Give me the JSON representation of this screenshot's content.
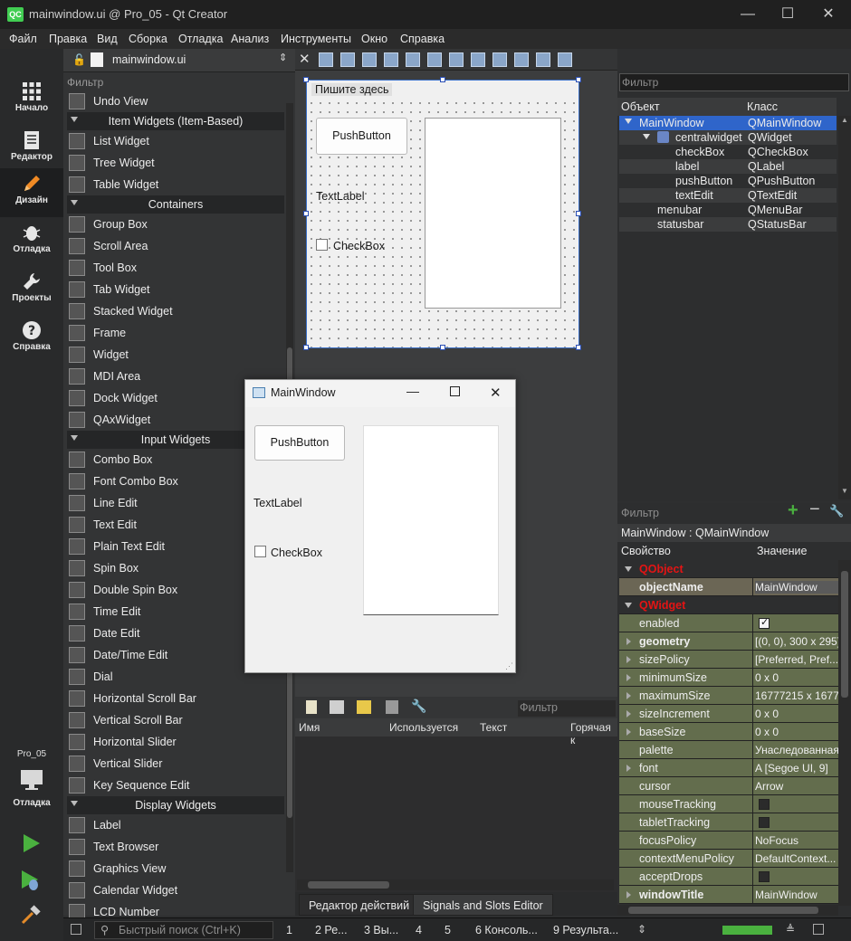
{
  "window": {
    "title": "mainwindow.ui @ Pro_05 - Qt Creator",
    "logo": "QC",
    "minimize": "—",
    "maximize": "☐",
    "close": "✕"
  },
  "menu": [
    "Файл",
    "Правка",
    "Вид",
    "Сборка",
    "Отладка",
    "Анализ",
    "Инструменты",
    "Окно",
    "Справка"
  ],
  "modes": [
    {
      "label": "Начало",
      "icon": "grid-icon"
    },
    {
      "label": "Редактор",
      "icon": "document-icon"
    },
    {
      "label": "Дизайн",
      "icon": "pencil-icon"
    },
    {
      "label": "Отладка",
      "icon": "bug-icon"
    },
    {
      "label": "Проекты",
      "icon": "wrench-icon"
    },
    {
      "label": "Справка",
      "icon": "help-icon"
    }
  ],
  "kit": {
    "project": "Pro_05",
    "config": "Отладка"
  },
  "file_combo": "mainwindow.ui",
  "widget_box": {
    "filter": "Фильтр",
    "items": [
      {
        "type": "item",
        "label": "Undo View"
      },
      {
        "type": "cat",
        "label": "Item Widgets (Item-Based)"
      },
      {
        "type": "item",
        "label": "List Widget"
      },
      {
        "type": "item",
        "label": "Tree Widget"
      },
      {
        "type": "item",
        "label": "Table Widget"
      },
      {
        "type": "cat",
        "label": "Containers"
      },
      {
        "type": "item",
        "label": "Group Box"
      },
      {
        "type": "item",
        "label": "Scroll Area"
      },
      {
        "type": "item",
        "label": "Tool Box"
      },
      {
        "type": "item",
        "label": "Tab Widget"
      },
      {
        "type": "item",
        "label": "Stacked Widget"
      },
      {
        "type": "item",
        "label": "Frame"
      },
      {
        "type": "item",
        "label": "Widget"
      },
      {
        "type": "item",
        "label": "MDI Area"
      },
      {
        "type": "item",
        "label": "Dock Widget"
      },
      {
        "type": "item",
        "label": "QAxWidget"
      },
      {
        "type": "cat",
        "label": "Input Widgets"
      },
      {
        "type": "item",
        "label": "Combo Box"
      },
      {
        "type": "item",
        "label": "Font Combo Box"
      },
      {
        "type": "item",
        "label": "Line Edit"
      },
      {
        "type": "item",
        "label": "Text Edit"
      },
      {
        "type": "item",
        "label": "Plain Text Edit"
      },
      {
        "type": "item",
        "label": "Spin Box"
      },
      {
        "type": "item",
        "label": "Double Spin Box"
      },
      {
        "type": "item",
        "label": "Time Edit"
      },
      {
        "type": "item",
        "label": "Date Edit"
      },
      {
        "type": "item",
        "label": "Date/Time Edit"
      },
      {
        "type": "item",
        "label": "Dial"
      },
      {
        "type": "item",
        "label": "Horizontal Scroll Bar"
      },
      {
        "type": "item",
        "label": "Vertical Scroll Bar"
      },
      {
        "type": "item",
        "label": "Horizontal Slider"
      },
      {
        "type": "item",
        "label": "Vertical Slider"
      },
      {
        "type": "item",
        "label": "Key Sequence Edit"
      },
      {
        "type": "cat",
        "label": "Display Widgets"
      },
      {
        "type": "item",
        "label": "Label"
      },
      {
        "type": "item",
        "label": "Text Browser"
      },
      {
        "type": "item",
        "label": "Graphics View"
      },
      {
        "type": "item",
        "label": "Calendar Widget"
      },
      {
        "type": "item",
        "label": "LCD Number"
      }
    ]
  },
  "form": {
    "menu_placeholder": "Пишите здесь",
    "push_button": "PushButton",
    "text_label": "TextLabel",
    "check_box": "CheckBox"
  },
  "preview": {
    "title": "MainWindow",
    "push_button": "PushButton",
    "text_label": "TextLabel",
    "check_box": "CheckBox"
  },
  "action_editor": {
    "filter": "Фильтр",
    "columns": [
      "Имя",
      "Используется",
      "Текст",
      "Горячая к"
    ],
    "tabs": [
      "Редактор действий",
      "Signals and Slots Editor"
    ]
  },
  "object_inspector": {
    "filter": "Фильтр",
    "col_object": "Объект",
    "col_class": "Класс",
    "rows": [
      {
        "object": "MainWindow",
        "class": "QMainWindow",
        "indent": 0
      },
      {
        "object": "centralwidget",
        "class": "QWidget",
        "indent": 1
      },
      {
        "object": "checkBox",
        "class": "QCheckBox",
        "indent": 2
      },
      {
        "object": "label",
        "class": "QLabel",
        "indent": 2
      },
      {
        "object": "pushButton",
        "class": "QPushButton",
        "indent": 2
      },
      {
        "object": "textEdit",
        "class": "QTextEdit",
        "indent": 2
      },
      {
        "object": "menubar",
        "class": "QMenuBar",
        "indent": 1
      },
      {
        "object": "statusbar",
        "class": "QStatusBar",
        "indent": 1
      }
    ]
  },
  "property_editor": {
    "filter": "Фильтр",
    "context": "MainWindow : QMainWindow",
    "col_property": "Свойство",
    "col_value": "Значение",
    "rows": [
      {
        "kind": "group",
        "name": "QObject"
      },
      {
        "kind": "prop",
        "name": "objectName",
        "value": "MainWindow",
        "bold": true,
        "shade": "obj"
      },
      {
        "kind": "group",
        "name": "QWidget"
      },
      {
        "kind": "prop",
        "name": "enabled",
        "value": "",
        "check": "on"
      },
      {
        "kind": "prop",
        "name": "geometry",
        "value": "[(0, 0), 300 x 295]",
        "bold": true,
        "expand": true
      },
      {
        "kind": "prop",
        "name": "sizePolicy",
        "value": "[Preferred, Pref...",
        "expand": true
      },
      {
        "kind": "prop",
        "name": "minimumSize",
        "value": "0 x 0",
        "expand": true
      },
      {
        "kind": "prop",
        "name": "maximumSize",
        "value": "16777215 x 1677...",
        "expand": true
      },
      {
        "kind": "prop",
        "name": "sizeIncrement",
        "value": "0 x 0",
        "expand": true
      },
      {
        "kind": "prop",
        "name": "baseSize",
        "value": "0 x 0",
        "expand": true
      },
      {
        "kind": "prop",
        "name": "palette",
        "value": "Унаследованная"
      },
      {
        "kind": "prop",
        "name": "font",
        "value": "A  [Segoe UI, 9]",
        "expand": true
      },
      {
        "kind": "prop",
        "name": "cursor",
        "value": "Arrow"
      },
      {
        "kind": "prop",
        "name": "mouseTracking",
        "value": "",
        "check": "off"
      },
      {
        "kind": "prop",
        "name": "tabletTracking",
        "value": "",
        "check": "off"
      },
      {
        "kind": "prop",
        "name": "focusPolicy",
        "value": "NoFocus"
      },
      {
        "kind": "prop",
        "name": "contextMenuPolicy",
        "value": "DefaultContext..."
      },
      {
        "kind": "prop",
        "name": "acceptDrops",
        "value": "",
        "check": "off"
      },
      {
        "kind": "prop",
        "name": "windowTitle",
        "value": "MainWindow",
        "bold": true,
        "expand": true
      }
    ]
  },
  "status_bar": {
    "search": "Быстрый поиск (Ctrl+K)",
    "panes": [
      "1",
      "2  Ре...",
      "3  Вы...",
      "4",
      "5",
      "6  Консоль...",
      "9  Результа..."
    ]
  },
  "colors": {
    "selection": "#2f65ca",
    "group_red": "#e41414",
    "prop_row": "#636d4d",
    "progress": "#4ab13f"
  }
}
